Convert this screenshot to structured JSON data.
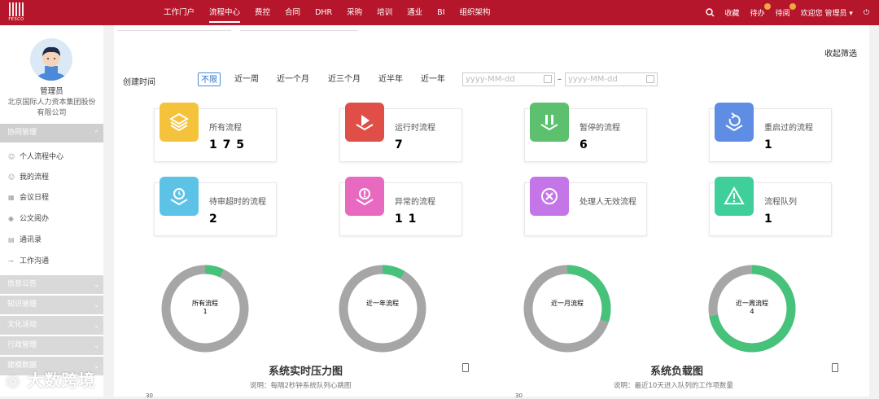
{
  "topbar": {
    "logo_text": "FESCO",
    "nav": [
      "工作门户",
      "流程中心",
      "费控",
      "合同",
      "DHR",
      "采购",
      "培训",
      "通业",
      "BI",
      "组织架构"
    ],
    "active_nav": "流程中心",
    "collect": "收藏",
    "todo": "待办",
    "pending": "待阅",
    "welcome": "欢迎您 管理员"
  },
  "sidebar": {
    "user_name": "管理员",
    "org": "北京国际人力资本集团股份有限公司",
    "sections": [
      {
        "label": "协同管理",
        "expanded": true,
        "items": [
          "个人流程中心",
          "我的流程",
          "会议日程",
          "公文阅办",
          "通讯录",
          "工作沟通"
        ]
      },
      {
        "label": "信息公告"
      },
      {
        "label": "知识管理"
      },
      {
        "label": "文化活动"
      },
      {
        "label": "行政管理"
      },
      {
        "label": "建模数据"
      }
    ]
  },
  "filter": {
    "collapse": "收起筛选",
    "label": "创建时间",
    "options": [
      "不限",
      "近一周",
      "近一个月",
      "近三个月",
      "近半年",
      "近一年"
    ],
    "selected": "不限",
    "date_placeholder": "yyyy-MM-dd",
    "separator": "–"
  },
  "cards": [
    {
      "label": "所有流程",
      "value": "1 7 5",
      "color": "#f5c23b"
    },
    {
      "label": "运行时流程",
      "value": "7",
      "color": "#e04f47"
    },
    {
      "label": "暂停的流程",
      "value": "6",
      "color": "#5cc06e"
    },
    {
      "label": "重启过的流程",
      "value": "1",
      "color": "#5e8de3"
    },
    {
      "label": "待审超时的流程",
      "value": "2",
      "color": "#5cc3e6"
    },
    {
      "label": "异常的流程",
      "value": "1 1",
      "color": "#e86ac0"
    },
    {
      "label": "处理人无效流程",
      "value": "",
      "color": "#c476e8"
    },
    {
      "label": "流程队列",
      "value": "1",
      "color": "#3fcf9a"
    }
  ],
  "donuts": [
    {
      "label": "所有流程",
      "value": "1",
      "fraction": 0.07
    },
    {
      "label": "近一年流程",
      "value": "",
      "fraction": 0.085
    },
    {
      "label": "近一月流程",
      "value": "",
      "fraction": 0.3
    },
    {
      "label": "近一周流程",
      "value": "4",
      "fraction": 0.72
    }
  ],
  "colors": {
    "accent": "#b5162b",
    "ring_base": "#a6a6a6",
    "ring_fill": "#46c27a"
  },
  "charts": [
    {
      "title": "系统实时压力图",
      "desc": "说明：每隔2秒钟系统队列心跳图",
      "axis": "30"
    },
    {
      "title": "系统负载图",
      "desc": "说明：最近10天进入队列的工作项数量",
      "axis": "30"
    }
  ],
  "watermark": "大数跨境"
}
